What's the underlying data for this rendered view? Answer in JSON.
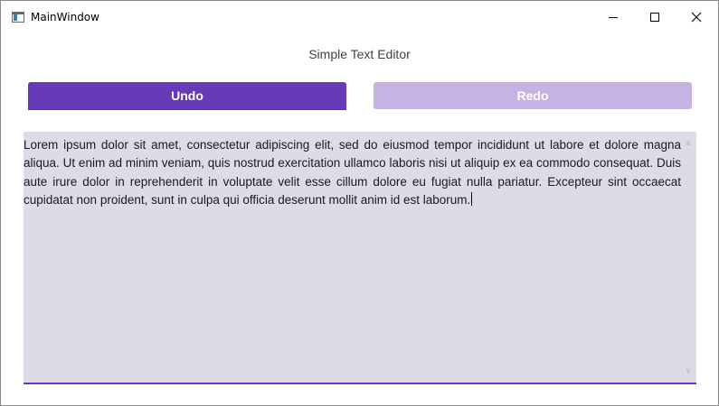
{
  "window": {
    "title": "MainWindow",
    "icon": "app-window-icon"
  },
  "heading": "Simple Text Editor",
  "toolbar": {
    "undo_label": "Undo",
    "redo_label": "Redo"
  },
  "editor": {
    "text": "Lorem ipsum dolor sit amet, consectetur adipiscing elit, sed do eiusmod tempor incididunt ut labore et dolore magna aliqua. Ut enim ad minim veniam, quis nostrud exercitation ullamco laboris nisi ut aliquip ex ea commodo consequat. Duis aute irure dolor in reprehenderit in voluptate velit esse cillum dolore eu fugiat nulla pariatur. Excepteur sint occaecat cupidatat non proident, sunt in culpa qui officia deserunt mollit anim id est laborum."
  },
  "colors": {
    "accent": "#673ab7",
    "accent_disabled": "#c5b3e3",
    "editor_background": "#dedbe6"
  }
}
